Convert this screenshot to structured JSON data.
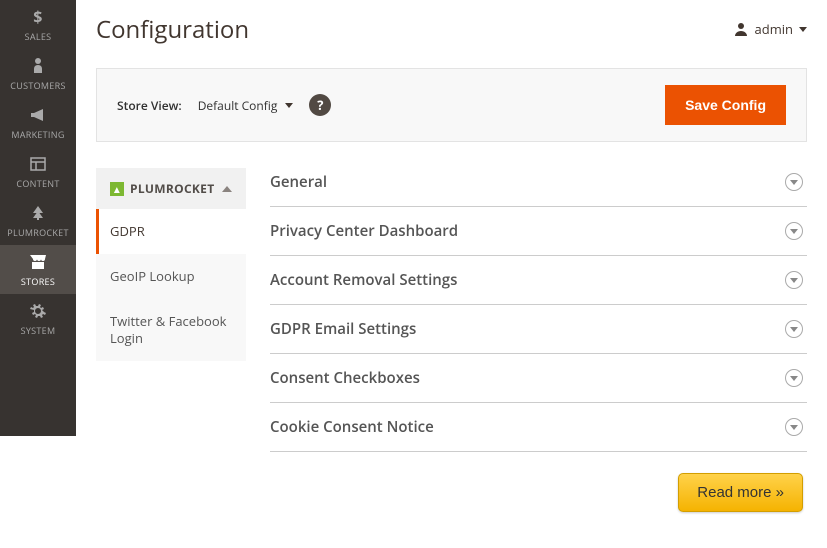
{
  "sidebar": {
    "items": [
      {
        "label": "SALES",
        "icon": "dollar"
      },
      {
        "label": "CUSTOMERS",
        "icon": "person"
      },
      {
        "label": "MARKETING",
        "icon": "megaphone"
      },
      {
        "label": "CONTENT",
        "icon": "layout"
      },
      {
        "label": "PLUMROCKET",
        "icon": "tree"
      },
      {
        "label": "STORES",
        "icon": "store",
        "active": true
      },
      {
        "label": "SYSTEM",
        "icon": "gear"
      }
    ]
  },
  "header": {
    "title": "Configuration",
    "admin_label": "admin"
  },
  "toolbar": {
    "scope_label": "Store View:",
    "scope_value": "Default Config",
    "help_tooltip": "?",
    "save_label": "Save Config"
  },
  "config_nav": {
    "group": "PLUMROCKET",
    "items": [
      {
        "label": "GDPR",
        "active": true
      },
      {
        "label": "GeoIP Lookup"
      },
      {
        "label": "Twitter & Facebook Login"
      }
    ]
  },
  "sections": [
    {
      "title": "General"
    },
    {
      "title": "Privacy Center Dashboard"
    },
    {
      "title": "Account Removal Settings"
    },
    {
      "title": "GDPR Email Settings"
    },
    {
      "title": "Consent Checkboxes"
    },
    {
      "title": "Cookie Consent Notice"
    }
  ],
  "readmore_label": "Read more »"
}
